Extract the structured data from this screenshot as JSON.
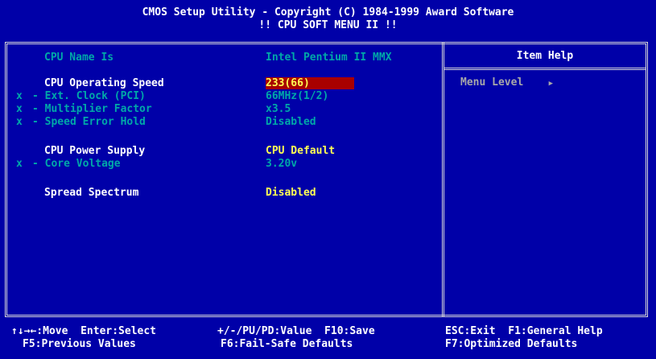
{
  "header": {
    "line1": "CMOS Setup Utility - Copyright (C) 1984-1999 Award Software",
    "line2": "!! CPU SOFT MENU II !!"
  },
  "settings": {
    "cpu_name": {
      "label": "CPU Name Is",
      "value": "Intel Pentium II MMX"
    },
    "cpu_speed": {
      "label": "CPU Operating Speed",
      "value": "233(66)"
    },
    "ext_clock": {
      "prefix": "x",
      "label": "- Ext. Clock (PCI)",
      "value": "66MHz(1/2)"
    },
    "multiplier": {
      "prefix": "x",
      "label": "- Multiplier Factor",
      "value": "x3.5"
    },
    "speed_error": {
      "prefix": "x",
      "label": "- Speed Error Hold",
      "value": "Disabled"
    },
    "power_supply": {
      "label": "CPU Power Supply",
      "value": "CPU Default"
    },
    "core_voltage": {
      "prefix": "x",
      "label": "- Core Voltage",
      "value": "3.20v"
    },
    "spread_spectrum": {
      "label": "Spread Spectrum",
      "value": "Disabled"
    }
  },
  "help": {
    "title": "Item Help",
    "menu_level": "Menu Level",
    "arrow": "▶"
  },
  "footer": {
    "keys1": "↑↓→←:Move  Enter:Select",
    "keys2": "F5:Previous Values",
    "keys3": "+/-/PU/PD:Value  F10:Save",
    "keys4": "F6:Fail-Safe Defaults",
    "keys5": "ESC:Exit  F1:General Help",
    "keys6": "F7:Optimized Defaults"
  },
  "colors": {
    "background": "#0000a8",
    "highlight": "#a80000",
    "value": "#ffff54",
    "disabled": "#00a8a8"
  }
}
